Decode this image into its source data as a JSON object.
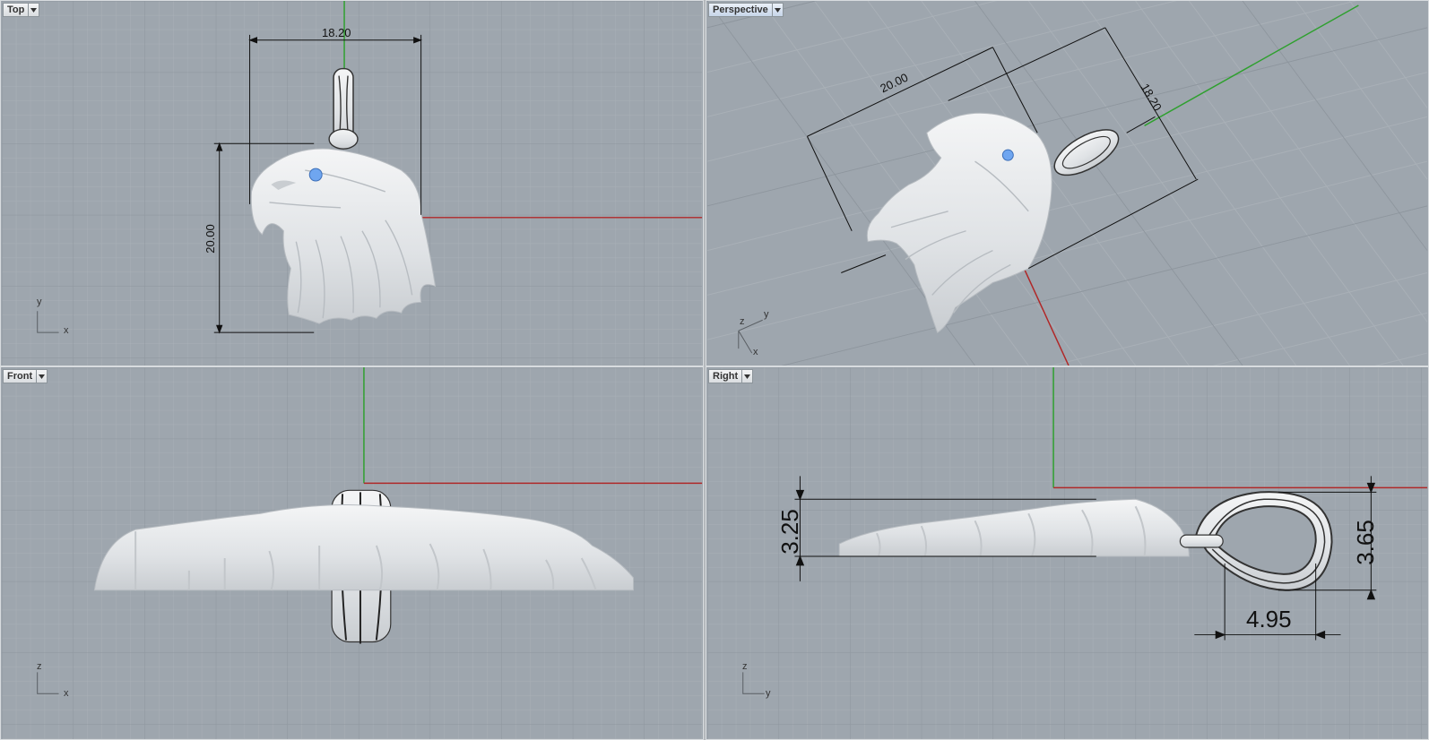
{
  "viewports": {
    "top": {
      "label": "Top",
      "dims": {
        "width": "18.20",
        "height": "20.00"
      },
      "axes": {
        "a": "y",
        "b": "x"
      }
    },
    "perspective": {
      "label": "Perspective",
      "dims": {
        "length": "20.00",
        "width": "18.20"
      },
      "axes": {
        "a": "z",
        "b": "y",
        "c": "x"
      }
    },
    "front": {
      "label": "Front",
      "axes": {
        "a": "z",
        "b": "x"
      }
    },
    "right": {
      "label": "Right",
      "dims": {
        "thickness": "3.25",
        "loop_height": "3.65",
        "loop_width": "4.95"
      },
      "axes": {
        "a": "z",
        "b": "y"
      }
    }
  },
  "icons": {
    "dropdown": "chevron-down-icon",
    "axis": "axis-indicator-icon"
  },
  "colors": {
    "viewport_bg": "#9ea6ae",
    "grid_minor": "#a9b0b7",
    "grid_major": "#8e969e",
    "x_axis": "#b02828",
    "y_axis": "#2fa02f",
    "model": "#e9ebed",
    "eye": "#6fa6f0",
    "dimension": "#111111"
  }
}
